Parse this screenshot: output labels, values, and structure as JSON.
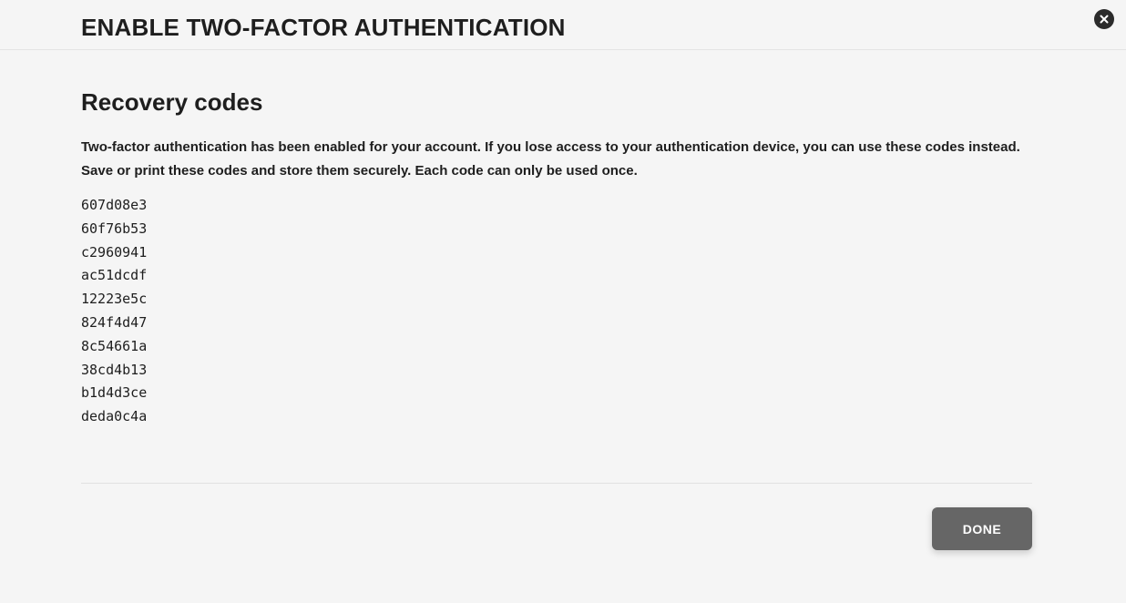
{
  "modal": {
    "title": "ENABLE TWO-FACTOR AUTHENTICATION",
    "close_icon": "close-icon"
  },
  "recovery": {
    "heading": "Recovery codes",
    "description": "Two-factor authentication has been enabled for your account. If you lose access to your authentication device, you can use these codes instead. Save or print these codes and store them securely. Each code can only be used once.",
    "codes": [
      "607d08e3",
      "60f76b53",
      "c2960941",
      "ac51dcdf",
      "12223e5c",
      "824f4d47",
      "8c54661a",
      "38cd4b13",
      "b1d4d3ce",
      "deda0c4a"
    ]
  },
  "footer": {
    "done_label": "DONE"
  },
  "colors": {
    "background": "#f5f5f5",
    "text": "#1e1e1e",
    "button": "#666666",
    "close_button": "#2b2b2b"
  }
}
